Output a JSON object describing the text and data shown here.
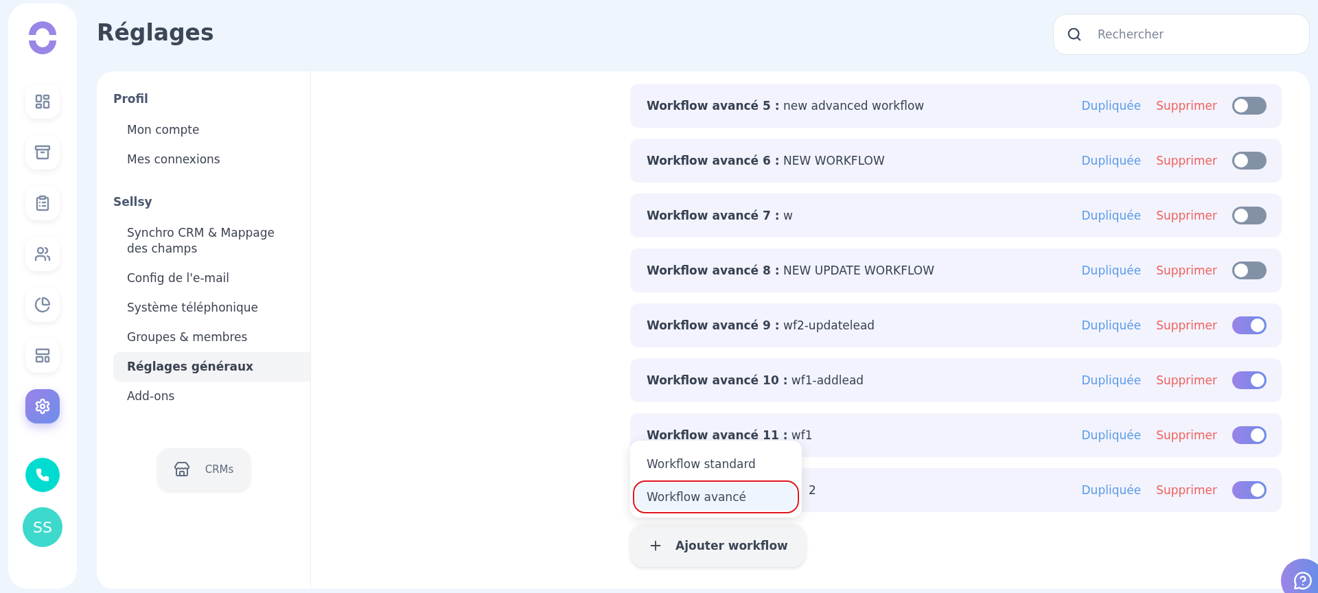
{
  "page_title": "Réglages",
  "search": {
    "placeholder": "Rechercher"
  },
  "nav": [
    {
      "kind": "dashboard",
      "selected": false
    },
    {
      "kind": "tray",
      "selected": false
    },
    {
      "kind": "clipboard",
      "selected": false
    },
    {
      "kind": "people",
      "selected": false
    },
    {
      "kind": "pie",
      "selected": false
    },
    {
      "kind": "layout",
      "selected": false
    },
    {
      "kind": "settings",
      "selected": true
    }
  ],
  "avatar": "SS",
  "settings_menu": [
    {
      "heading": "Profil",
      "items": [
        {
          "label": "Mon compte",
          "selected": false
        },
        {
          "label": "Mes connexions",
          "selected": false
        }
      ]
    },
    {
      "heading": "Sellsy",
      "items": [
        {
          "label": "Synchro CRM & Mappage des champs",
          "selected": false
        },
        {
          "label": "Config de l'e-mail",
          "selected": false
        },
        {
          "label": "Système téléphonique",
          "selected": false
        },
        {
          "label": "Groupes & membres",
          "selected": false
        },
        {
          "label": "Réglages généraux",
          "selected": true
        },
        {
          "label": "Add-ons",
          "selected": false
        }
      ]
    }
  ],
  "crm_button": "CRMs",
  "workflows": [
    {
      "title": "Workflow avancé 5 :",
      "name": "new advanced workflow",
      "duplicate": "Dupliquée",
      "delete": "Supprimer",
      "on": false
    },
    {
      "title": "Workflow avancé 6 :",
      "name": "NEW WORKFLOW",
      "duplicate": "Dupliquée",
      "delete": "Supprimer",
      "on": false
    },
    {
      "title": "Workflow avancé 7 :",
      "name": "w",
      "duplicate": "Dupliquée",
      "delete": "Supprimer",
      "on": false
    },
    {
      "title": "Workflow avancé 8 :",
      "name": "NEW UPDATE WORKFLOW",
      "duplicate": "Dupliquée",
      "delete": "Supprimer",
      "on": false
    },
    {
      "title": "Workflow avancé 9 :",
      "name": "wf2-updatelead",
      "duplicate": "Dupliquée",
      "delete": "Supprimer",
      "on": true
    },
    {
      "title": "Workflow avancé 10 :",
      "name": "wf1-addlead",
      "duplicate": "Dupliquée",
      "delete": "Supprimer",
      "on": true
    },
    {
      "title": "Workflow avancé 11 :",
      "name": "wf1",
      "duplicate": "Dupliquée",
      "delete": "Supprimer",
      "on": true
    },
    {
      "name": "2",
      "duplicate": "Dupliquée",
      "delete": "Supprimer",
      "on": true
    }
  ],
  "add_menu": [
    {
      "label": "Workflow standard",
      "selected": false
    },
    {
      "label": "Workflow avancé",
      "selected": true
    }
  ],
  "add_button": "Ajouter workflow"
}
